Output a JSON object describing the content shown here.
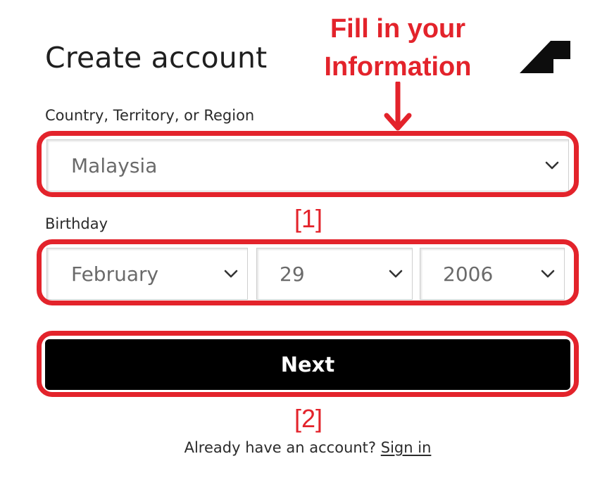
{
  "header": {
    "title": "Create account",
    "logo": "autodesk-logo"
  },
  "annotation": {
    "line1": "Fill in your",
    "line2": "Information",
    "step1": "[1]",
    "step2": "[2]",
    "color": "#e3232b"
  },
  "form": {
    "country": {
      "label": "Country, Territory, or Region",
      "value": "Malaysia"
    },
    "birthday": {
      "label": "Birthday",
      "month": "February",
      "day": "29",
      "year": "2006"
    },
    "next_label": "Next"
  },
  "footer": {
    "prompt": "Already have an account?",
    "link": "Sign in"
  }
}
